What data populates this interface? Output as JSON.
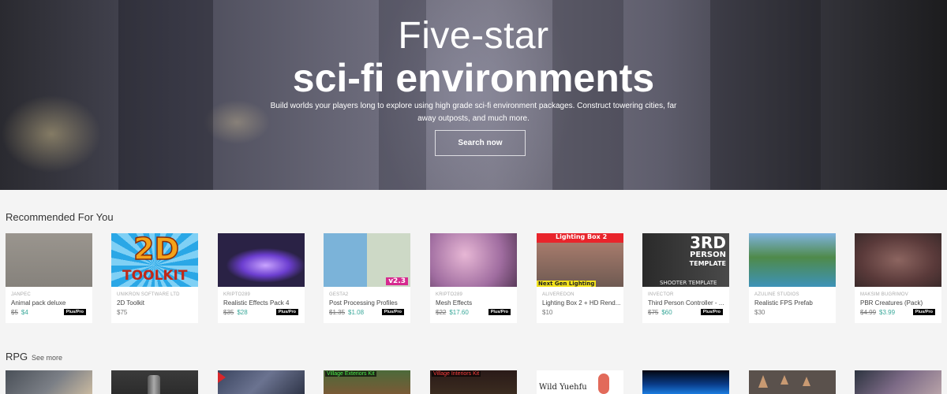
{
  "hero": {
    "title_light": "Five-star",
    "title_bold": "sci-fi environments",
    "description": "Build worlds your players long to explore using high grade sci-fi environment packages. Construct towering cities, far away outposts, and much more.",
    "button_label": "Search now"
  },
  "recommended": {
    "title": "Recommended For You",
    "items": [
      {
        "publisher": "JANPEC",
        "name": "Animal pack deluxe",
        "old_price": "$5",
        "price": "$4",
        "badge": "Plus/Pro",
        "thumb": "animals"
      },
      {
        "publisher": "UNIKRON SOFTWARE LTD",
        "name": "2D Toolkit",
        "old_price": "",
        "price": "$75",
        "badge": "",
        "thumb": "2d-toolkit"
      },
      {
        "publisher": "KRIPTO289",
        "name": "Realistic Effects Pack 4",
        "old_price": "$35",
        "price": "$28",
        "badge": "Plus/Pro",
        "thumb": "effects"
      },
      {
        "publisher": "GESTA2",
        "name": "Post Processing Profiles",
        "old_price": "$1.35",
        "price": "$1.08",
        "badge": "Plus/Pro",
        "thumb": "post-processing"
      },
      {
        "publisher": "KRIPTO289",
        "name": "Mesh Effects",
        "old_price": "$22",
        "price": "$17.60",
        "badge": "Plus/Pro",
        "thumb": "mesh-effects"
      },
      {
        "publisher": "ALIVEREDON",
        "name": "Lighting Box 2 + HD Rend...",
        "old_price": "",
        "price": "$10",
        "badge": "",
        "thumb": "lighting-box"
      },
      {
        "publisher": "INVECTOR",
        "name": "Third Person Controller - ...",
        "old_price": "$75",
        "price": "$60",
        "badge": "Plus/Pro",
        "thumb": "third-person"
      },
      {
        "publisher": "AZULINE STUDIOS",
        "name": "Realistic FPS Prefab",
        "old_price": "",
        "price": "$30",
        "badge": "",
        "thumb": "fps"
      },
      {
        "publisher": "MAKSIM BUGRIMOV",
        "name": "PBR Creatures (Pack)",
        "old_price": "$4.99",
        "price": "$3.99",
        "badge": "Plus/Pro",
        "thumb": "creatures"
      }
    ],
    "thumb_text": {
      "toolkit_2d": "2D",
      "toolkit_word": "TOOLKIT",
      "pp_version": "v2.3",
      "lighting_top": "Lighting Box 2",
      "lighting_bottom": "Next Gen Lighting",
      "tp_big": "3RD",
      "tp_person": "PERSON",
      "tp_template": "TEMPLATE",
      "tp_bottom": "SHOOTER TEMPLATE"
    }
  },
  "rpg": {
    "title": "RPG",
    "see_more": "See more",
    "thumb_tags": {
      "exteriors": "Village Exteriors Kit",
      "interiors": "Village Interiors Kit",
      "yuehfu": "Wild Yuehfu"
    }
  }
}
